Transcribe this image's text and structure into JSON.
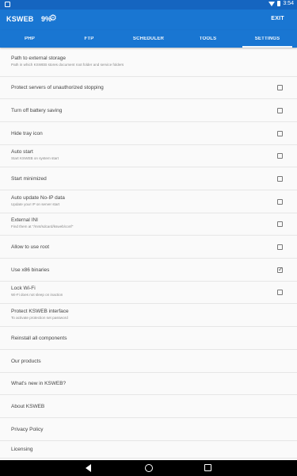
{
  "status": {
    "time": "3:54"
  },
  "appbar": {
    "title": "KSWEB",
    "percent": "9%",
    "exit_label": "EXIT"
  },
  "tabs": [
    "PHP",
    "FTP",
    "SCHEDULER",
    "TOOLS",
    "SETTINGS"
  ],
  "active_tab": "SETTINGS",
  "settings": [
    {
      "title": "Path to external storage",
      "subtitle": "Path in which KSWEB stores document root folder and service folders",
      "checkbox": null
    },
    {
      "title": "Protect servers of unauthorized stopping",
      "subtitle": "",
      "checkbox": false
    },
    {
      "title": "Turn off battery saving",
      "subtitle": "",
      "checkbox": false
    },
    {
      "title": "Hide tray icon",
      "subtitle": "",
      "checkbox": false
    },
    {
      "title": "Auto start",
      "subtitle": "Start KSWEB on system start",
      "checkbox": false
    },
    {
      "title": "Start minimized",
      "subtitle": "",
      "checkbox": false
    },
    {
      "title": "Auto update No-IP data",
      "subtitle": "Update your IP on server start",
      "checkbox": false
    },
    {
      "title": "External INI",
      "subtitle": "Find them at \"/mnt/sdcard/ksweb/conf\"",
      "checkbox": false
    },
    {
      "title": "Allow to use root",
      "subtitle": "",
      "checkbox": false
    },
    {
      "title": "Use x86 binaries",
      "subtitle": "",
      "checkbox": true
    },
    {
      "title": "Lock Wi-Fi",
      "subtitle": "Wi-Fi does not sleep on inaction",
      "checkbox": false
    },
    {
      "title": "Protect KSWEB interface",
      "subtitle": "To activate protection set password",
      "checkbox": null
    },
    {
      "title": "Reinstall all components",
      "subtitle": "",
      "checkbox": null
    },
    {
      "title": "Our products",
      "subtitle": "",
      "checkbox": null
    },
    {
      "title": "What's new in KSWEB?",
      "subtitle": "",
      "checkbox": null
    },
    {
      "title": "About KSWEB",
      "subtitle": "",
      "checkbox": null
    },
    {
      "title": "Privacy Policy",
      "subtitle": "",
      "checkbox": null
    },
    {
      "title": "Licensing",
      "subtitle": "",
      "checkbox": null
    }
  ],
  "colors": {
    "appbar": "#1976d2",
    "statusbar": "#1565c0",
    "background": "#fafafa"
  },
  "icons": {
    "gear": "gear-icon",
    "back": "back-icon",
    "home": "home-icon",
    "recent": "recent-apps-icon"
  }
}
